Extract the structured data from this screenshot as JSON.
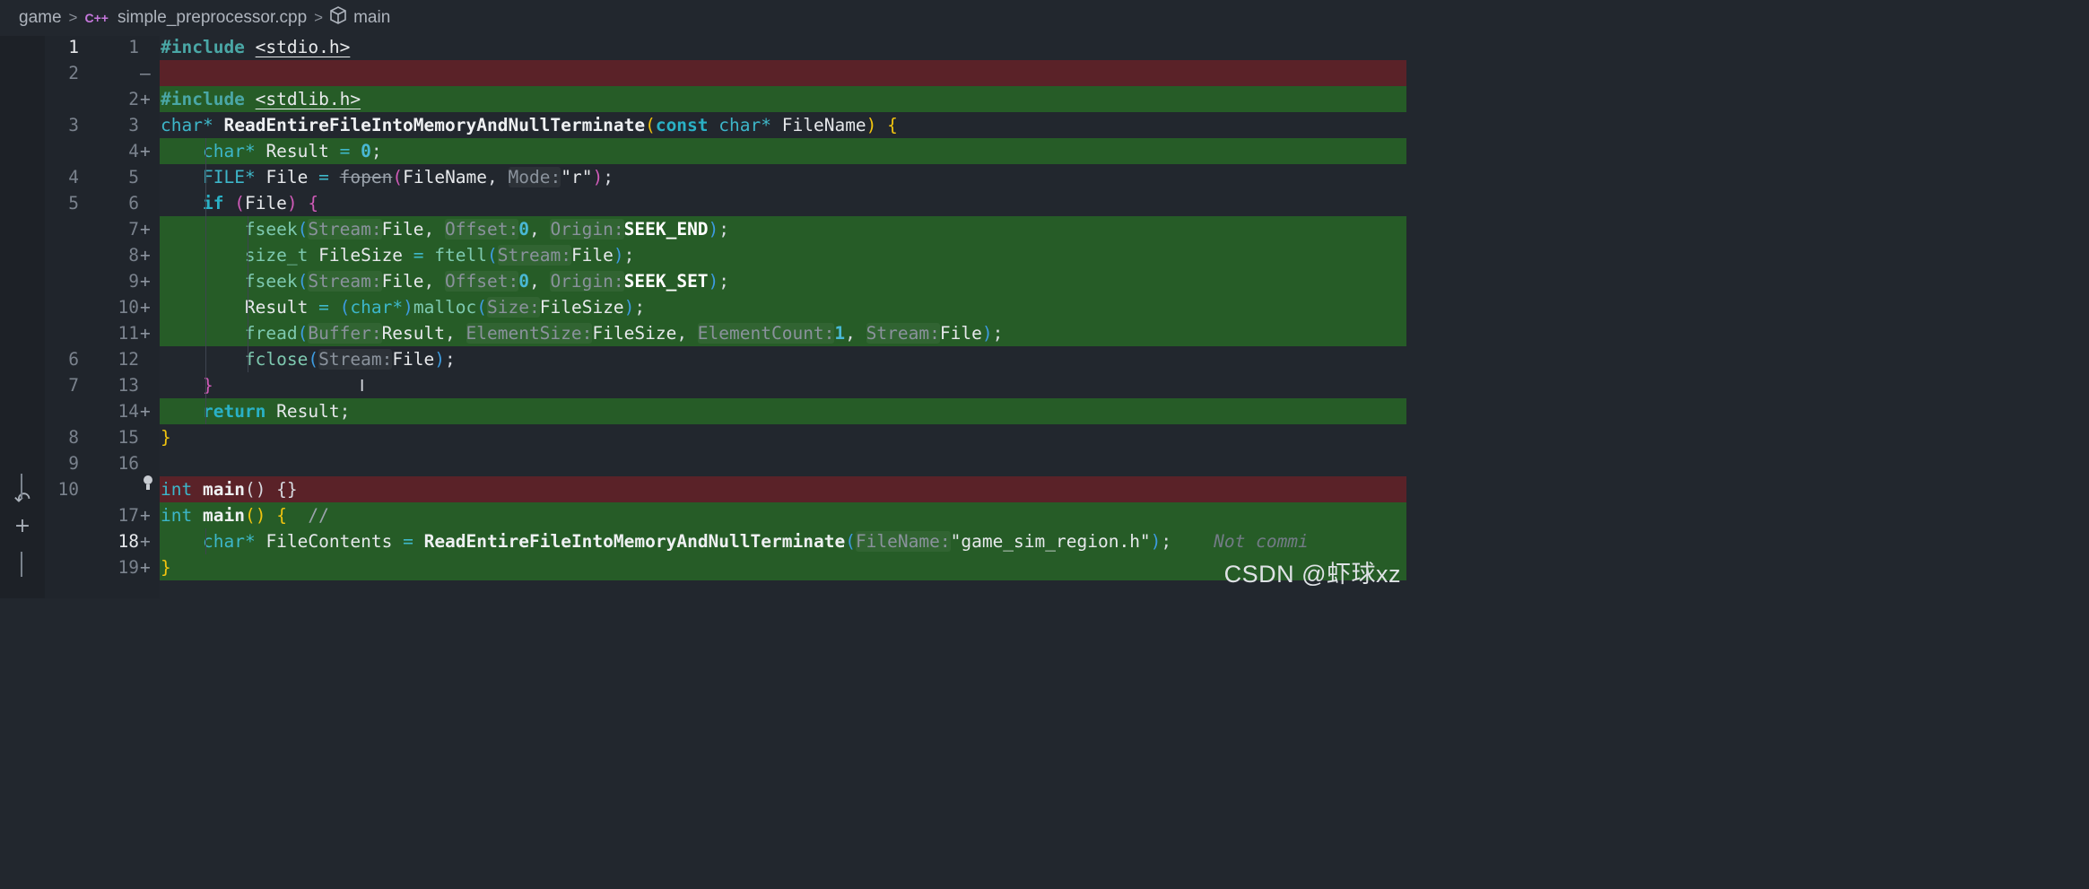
{
  "breadcrumb": {
    "folder": "game",
    "file_icon": "C++",
    "file": "simple_preprocessor.cpp",
    "symbol": "main"
  },
  "lines": [
    {
      "old": "1",
      "new": "1",
      "marker": "",
      "kind": "normal",
      "current": true
    },
    {
      "old": "2",
      "new": "",
      "marker": "—",
      "kind": "del"
    },
    {
      "old": "",
      "new": "2",
      "marker": "+",
      "kind": "add"
    },
    {
      "old": "3",
      "new": "3",
      "marker": "",
      "kind": "normal"
    },
    {
      "old": "",
      "new": "4",
      "marker": "+",
      "kind": "add"
    },
    {
      "old": "4",
      "new": "5",
      "marker": "",
      "kind": "normal"
    },
    {
      "old": "5",
      "new": "6",
      "marker": "",
      "kind": "normal"
    },
    {
      "old": "",
      "new": "7",
      "marker": "+",
      "kind": "add"
    },
    {
      "old": "",
      "new": "8",
      "marker": "+",
      "kind": "add"
    },
    {
      "old": "",
      "new": "9",
      "marker": "+",
      "kind": "add"
    },
    {
      "old": "",
      "new": "10",
      "marker": "+",
      "kind": "add"
    },
    {
      "old": "",
      "new": "11",
      "marker": "+",
      "kind": "add"
    },
    {
      "old": "6",
      "new": "12",
      "marker": "",
      "kind": "normal"
    },
    {
      "old": "7",
      "new": "13",
      "marker": "",
      "kind": "normal"
    },
    {
      "old": "",
      "new": "14",
      "marker": "+",
      "kind": "add"
    },
    {
      "old": "8",
      "new": "15",
      "marker": "",
      "kind": "normal"
    },
    {
      "old": "9",
      "new": "16",
      "marker": "",
      "kind": "normal"
    },
    {
      "old": "10",
      "new": "",
      "marker": "",
      "kind": "del"
    },
    {
      "old": "",
      "new": "17",
      "marker": "+",
      "kind": "add"
    },
    {
      "old": "",
      "new": "18",
      "marker": "+",
      "kind": "add",
      "current_new": true
    },
    {
      "old": "",
      "new": "19",
      "marker": "+",
      "kind": "add"
    }
  ],
  "code": {
    "l1_directive": "#include",
    "l1_file": "<stdio.h>",
    "l3_directive": "#include",
    "l3_file": "<stdlib.h>",
    "char": "char",
    "star": "*",
    "func_name": "ReadEntireFileIntoMemoryAndNullTerminate",
    "const": "const",
    "param_name": "FileName",
    "result_var": "Result",
    "zero": "0",
    "file_type": "FILE",
    "file_var": "File",
    "fopen": "fopen",
    "mode_hint": "Mode:",
    "mode_value": "\"r\"",
    "if_kw": "if",
    "fseek": "fseek",
    "stream_hint": "Stream:",
    "offset_hint": "Offset:",
    "origin_hint": "Origin:",
    "seek_end": "SEEK_END",
    "seek_set": "SEEK_SET",
    "size_t": "size_t",
    "filesize_var": "FileSize",
    "ftell": "ftell",
    "malloc": "malloc",
    "size_hint": "Size:",
    "fread": "fread",
    "buffer_hint": "Buffer:",
    "elementsize_hint": "ElementSize:",
    "elementcount_hint": "ElementCount:",
    "one": "1",
    "fclose": "fclose",
    "return_kw": "return",
    "int_kw": "int",
    "main_fn": "main",
    "comment": "//",
    "filecontents_var": "FileContents",
    "filename_hint": "FileName:",
    "filename_value": "\"game_sim_region.h\"",
    "blame_text": "Not commi"
  },
  "watermark": "CSDN @虾球xz"
}
